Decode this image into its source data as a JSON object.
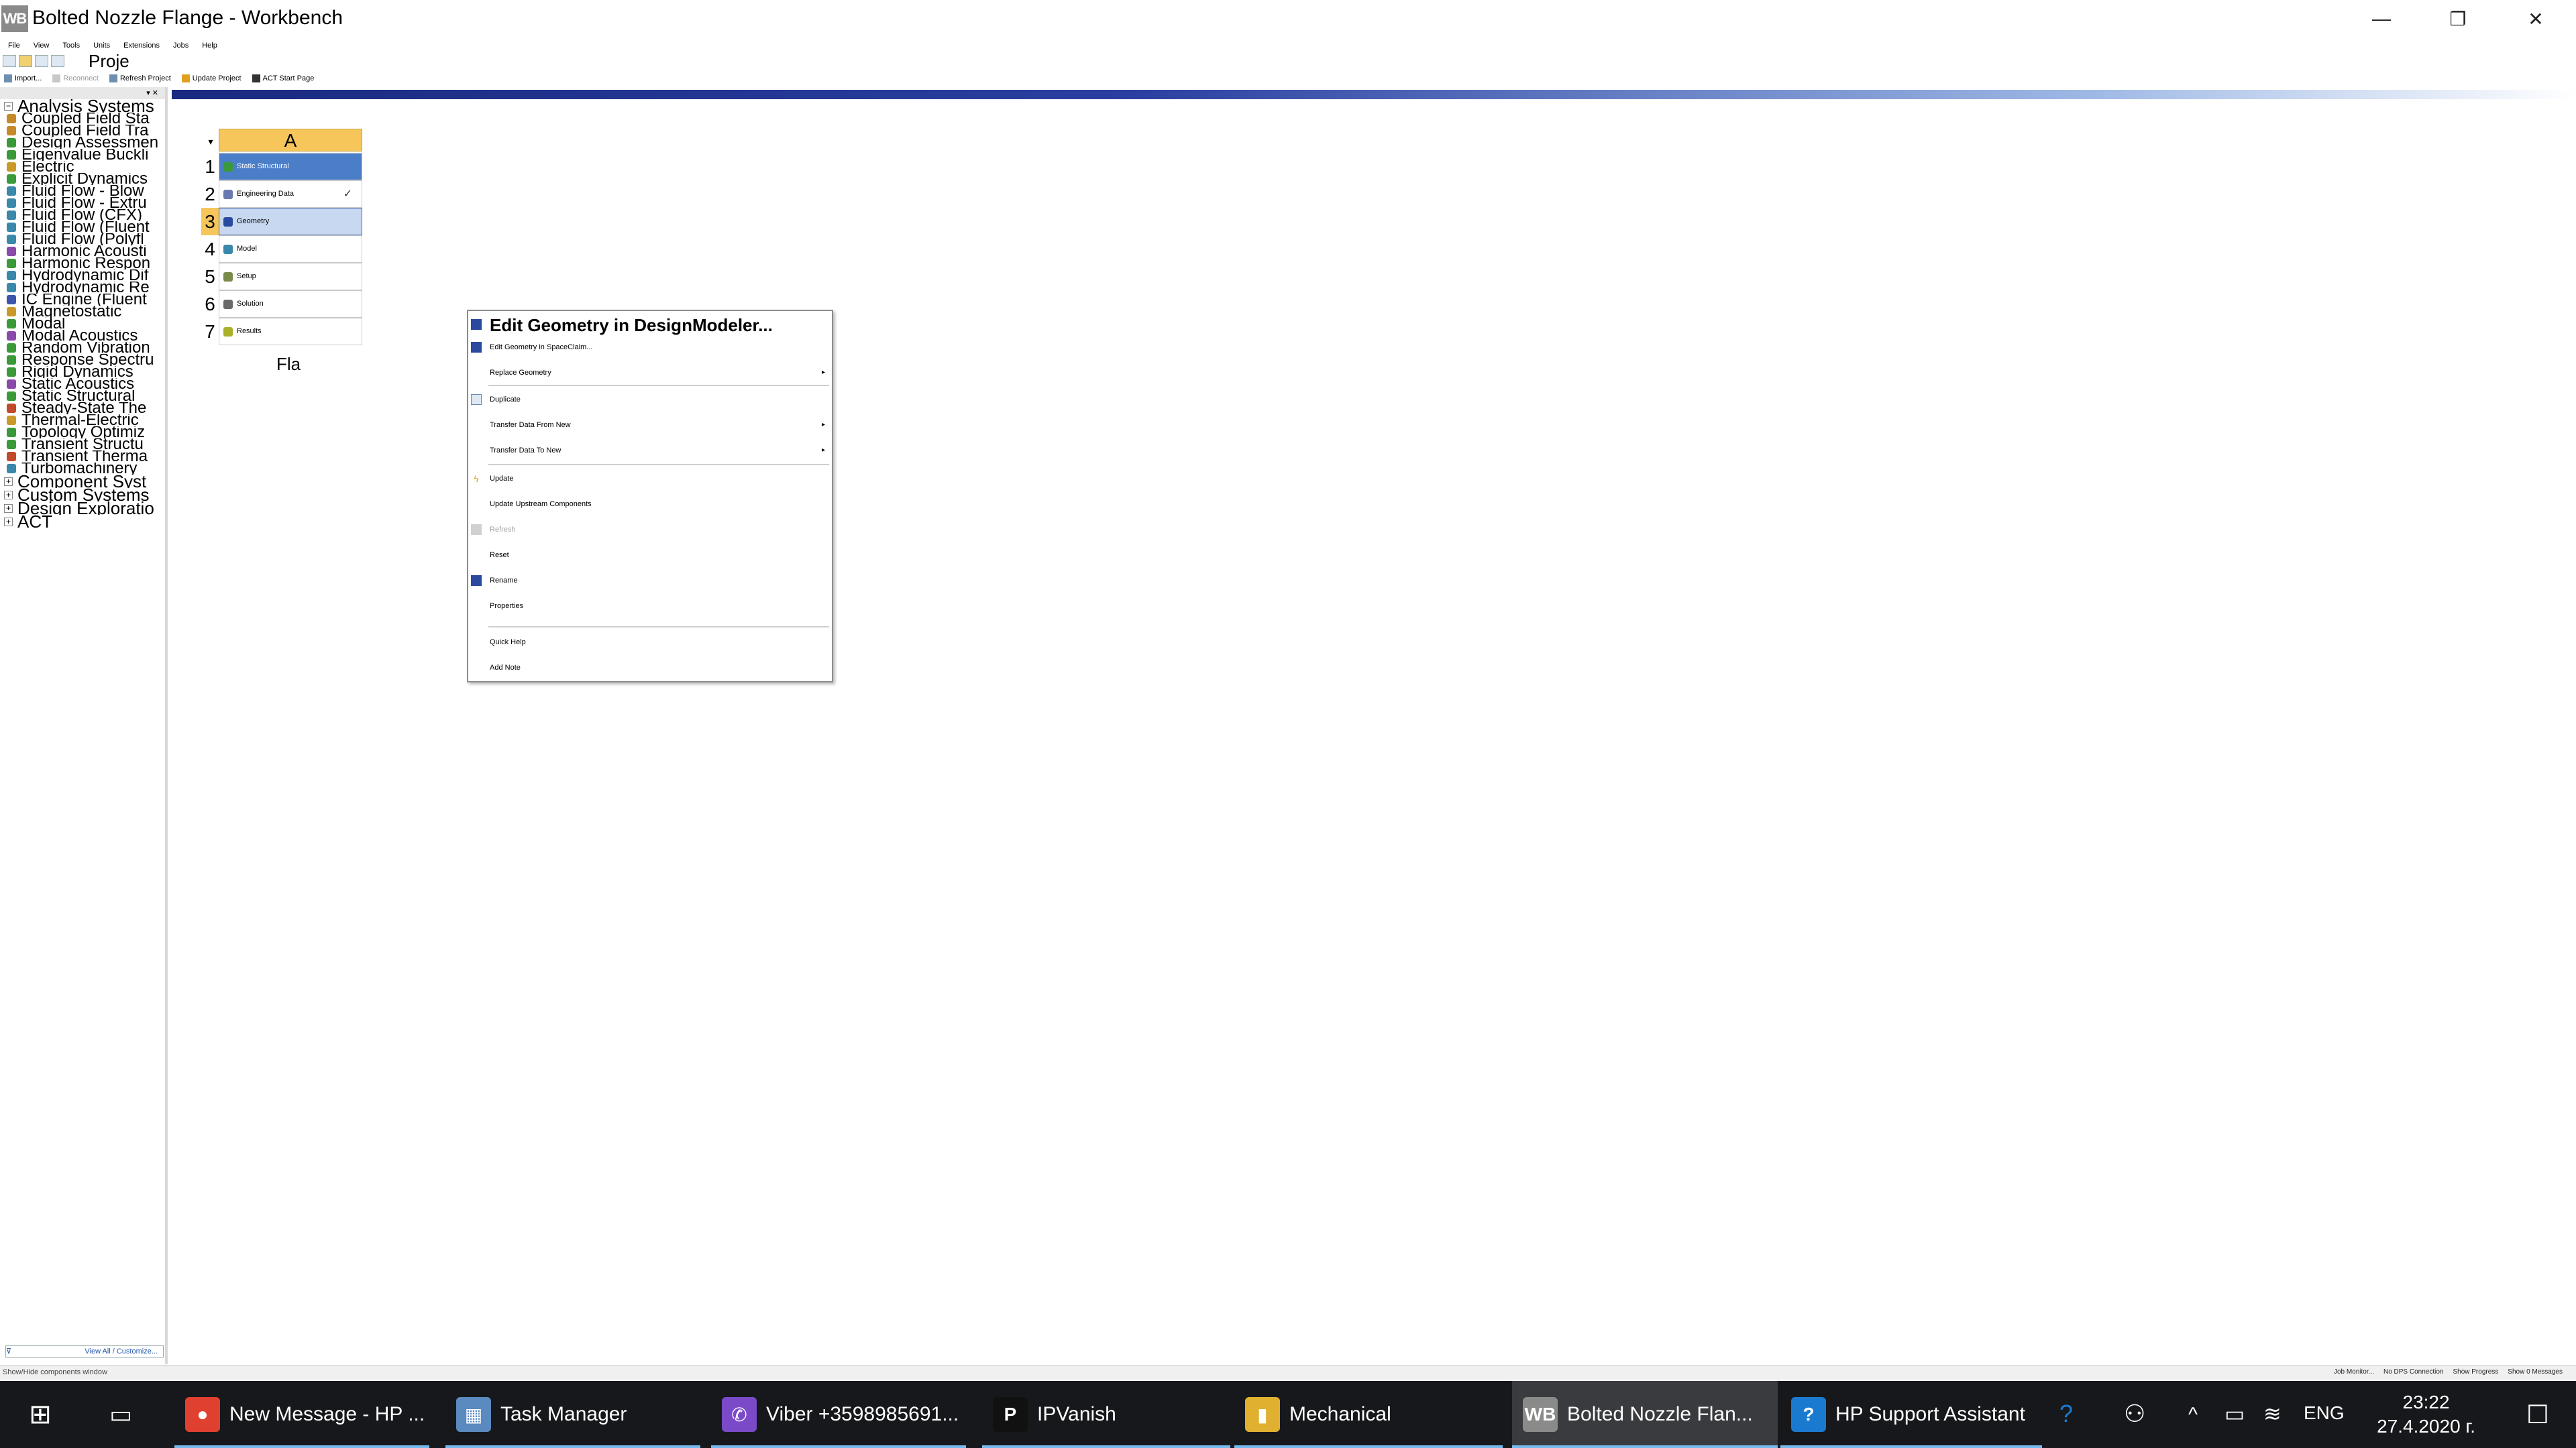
{
  "window": {
    "logo": "WB",
    "title": "Bolted Nozzle Flange - Workbench",
    "minimize_glyph": "—",
    "restore_glyph": "❐",
    "close_glyph": "✕"
  },
  "menu": [
    "File",
    "View",
    "Tools",
    "Units",
    "Extensions",
    "Jobs",
    "Help"
  ],
  "tab_label": "Proje",
  "toolbar2": {
    "import": "Import...",
    "reconnect": "Reconnect",
    "refresh": "Refresh Project",
    "update": "Update Project",
    "act_start": "ACT Start Page"
  },
  "toolbox": {
    "header_glyphs": "▾ ✕",
    "analysis_group": "Analysis Systems",
    "items": [
      {
        "label": "Coupled Field Sta",
        "color": "#c48a2a"
      },
      {
        "label": "Coupled Field Tra",
        "color": "#c48a2a"
      },
      {
        "label": "Design Assessmen",
        "color": "#3a9a3a"
      },
      {
        "label": "Eigenvalue Buckli",
        "color": "#3a9a3a"
      },
      {
        "label": "Electric",
        "color": "#c99a2a"
      },
      {
        "label": "Explicit Dynamics",
        "color": "#3a9a3a"
      },
      {
        "label": "Fluid Flow - Blow",
        "color": "#3a88aa"
      },
      {
        "label": "Fluid Flow - Extru",
        "color": "#3a88aa"
      },
      {
        "label": "Fluid Flow (CFX)",
        "color": "#3a88aa"
      },
      {
        "label": "Fluid Flow (Fluent",
        "color": "#3a88aa"
      },
      {
        "label": "Fluid Flow (Polyfl",
        "color": "#3a88aa"
      },
      {
        "label": "Harmonic Acousti",
        "color": "#8a4aaa"
      },
      {
        "label": "Harmonic Respon",
        "color": "#3a9a3a"
      },
      {
        "label": "Hydrodynamic Dif",
        "color": "#3a88aa"
      },
      {
        "label": "Hydrodynamic Re",
        "color": "#3a88aa"
      },
      {
        "label": "IC Engine (Fluent",
        "color": "#3a55aa"
      },
      {
        "label": "Magnetostatic",
        "color": "#c99a2a"
      },
      {
        "label": "Modal",
        "color": "#3a9a3a"
      },
      {
        "label": "Modal Acoustics",
        "color": "#8a4aaa"
      },
      {
        "label": "Random Vibration",
        "color": "#3a9a3a"
      },
      {
        "label": "Response Spectru",
        "color": "#3a9a3a"
      },
      {
        "label": "Rigid Dynamics",
        "color": "#3a9a3a"
      },
      {
        "label": "Static Acoustics",
        "color": "#8a4aaa"
      },
      {
        "label": "Static Structural",
        "color": "#3a9a3a"
      },
      {
        "label": "Steady-State The",
        "color": "#c04a2a"
      },
      {
        "label": "Thermal-Electric",
        "color": "#c99a2a"
      },
      {
        "label": "Topology Optimiz",
        "color": "#3a9a3a"
      },
      {
        "label": "Transient Structu",
        "color": "#3a9a3a"
      },
      {
        "label": "Transient Therma",
        "color": "#c04a2a"
      },
      {
        "label": "Turbomachinery",
        "color": "#3a88aa"
      }
    ],
    "groups_after": [
      "Component Syst",
      "Custom Systems",
      "Design Exploratio",
      "ACT"
    ],
    "footer": "View All / Customize..."
  },
  "system": {
    "column": "A",
    "dropdown_glyph": "▾",
    "cells": [
      {
        "num": "1",
        "label": "Static Structural",
        "icon_color": "#3a9a3a",
        "check": ""
      },
      {
        "num": "2",
        "label": "Engineering Data",
        "icon_color": "#6a7ab0",
        "check": "✓"
      },
      {
        "num": "3",
        "label": "Geometry",
        "icon_color": "#2a4aa0",
        "check": ""
      },
      {
        "num": "4",
        "label": "Model",
        "icon_color": "#3a88aa",
        "check": ""
      },
      {
        "num": "5",
        "label": "Setup",
        "icon_color": "#7a8a4a",
        "check": ""
      },
      {
        "num": "6",
        "label": "Solution",
        "icon_color": "#6a6a6a",
        "check": ""
      },
      {
        "num": "7",
        "label": "Results",
        "icon_color": "#aab02a",
        "check": ""
      }
    ],
    "name_partial": "Fla"
  },
  "context_menu": {
    "edit_dm": "Edit Geometry in DesignModeler...",
    "edit_sc": "Edit Geometry in SpaceClaim...",
    "replace": "Replace Geometry",
    "duplicate": "Duplicate",
    "transfer_from": "Transfer Data From New",
    "transfer_to": "Transfer Data To New",
    "update": "Update",
    "update_upstream": "Update Upstream Components",
    "refresh": "Refresh",
    "reset": "Reset",
    "rename": "Rename",
    "properties": "Properties",
    "quick_help": "Quick Help",
    "add_note": "Add Note",
    "submenu_glyph": "▸"
  },
  "statusbar": {
    "left": "Show/Hide components window",
    "right": [
      "Job Monitor...",
      "No DPS Connection",
      "Show Progress",
      "Show 0 Messages"
    ]
  },
  "taskbar": {
    "apps": [
      {
        "label": "New Message - HP ...",
        "icon": "●",
        "color": "#e04030"
      },
      {
        "label": "Task Manager",
        "icon": "▦",
        "color": "#5a8ac0"
      },
      {
        "label": "Viber +3598985691...",
        "icon": "✆",
        "color": "#7a4ac8"
      },
      {
        "label": "IPVanish",
        "icon": "P",
        "color": "#111"
      },
      {
        "label": "Mechanical",
        "icon": "▮",
        "color": "#e0b030"
      },
      {
        "label": "Bolted Nozzle Flan...",
        "icon": "WB",
        "color": "#8a8a8a"
      },
      {
        "label": "HP Support Assistant",
        "icon": "?",
        "color": "#1a7ad0"
      }
    ],
    "tray_help": "?",
    "tray_people": "⚇",
    "tray_chevron": "^",
    "tray_battery": "▭",
    "tray_wifi": "≋",
    "tray_lang": "ENG",
    "time": "23:22",
    "date": "27.4.2020 г.",
    "notifications": "☐"
  }
}
